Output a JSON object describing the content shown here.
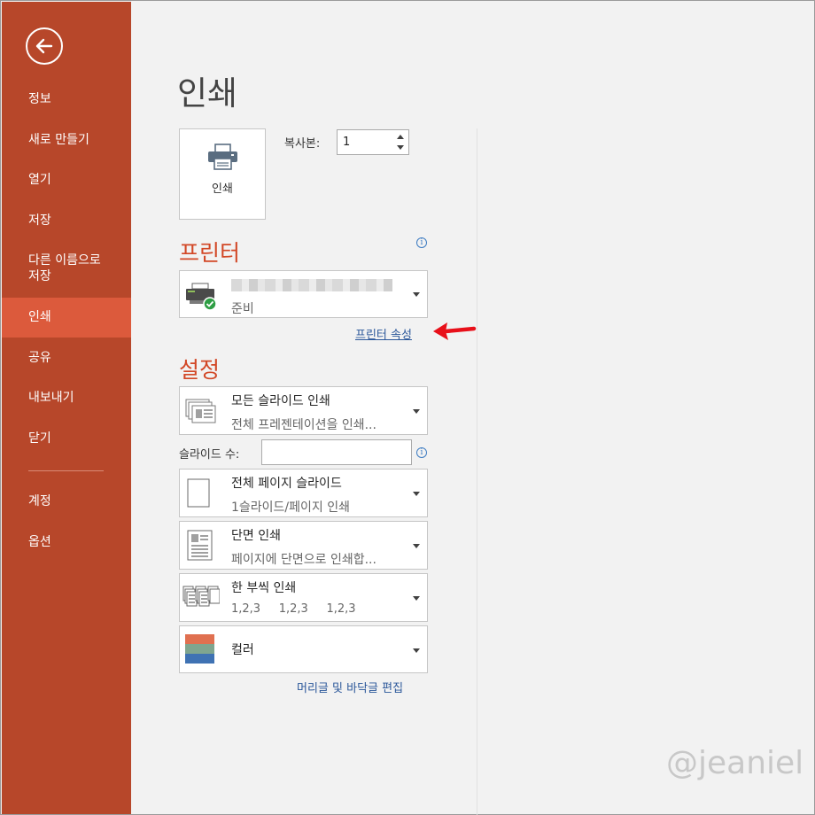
{
  "sidebar": {
    "items": [
      {
        "label": "정보"
      },
      {
        "label": "새로 만들기"
      },
      {
        "label": "열기"
      },
      {
        "label": "저장"
      },
      {
        "label": "다른 이름으로\n저장"
      },
      {
        "label": "인쇄"
      },
      {
        "label": "공유"
      },
      {
        "label": "내보내기"
      },
      {
        "label": "닫기"
      },
      {
        "label": "계정"
      },
      {
        "label": "옵션"
      }
    ],
    "active": "인쇄"
  },
  "main": {
    "title": "인쇄",
    "print_button_label": "인쇄",
    "copies": {
      "label": "복사본:",
      "value": "1"
    }
  },
  "printer": {
    "section_title": "프린터",
    "status": "준비",
    "properties_link": "프린터 속성"
  },
  "settings": {
    "section_title": "설정",
    "slides_dropdown": {
      "main": "모든 슬라이드 인쇄",
      "sub": "전체 프레젠테이션을 인쇄..."
    },
    "slide_count": {
      "label": "슬라이드 수:",
      "value": ""
    },
    "layout_dropdown": {
      "main": "전체 페이지 슬라이드",
      "sub": "1슬라이드/페이지 인쇄"
    },
    "sides_dropdown": {
      "main": "단면 인쇄",
      "sub": "페이지에 단면으로 인쇄합..."
    },
    "collate_dropdown": {
      "main": "한 부씩 인쇄",
      "sub": "1,2,3     1,2,3     1,2,3"
    },
    "color_dropdown": {
      "main": "컬러"
    },
    "header_footer_link": "머리글 및 바닥글 편집"
  },
  "watermark": "@jeaniel",
  "colors": {
    "sidebar_bg": "#b7472a",
    "sidebar_active": "#dc5a3c",
    "accent_title": "#d24726",
    "link": "#2b579a",
    "annotation_arrow": "#e8101a"
  },
  "icons": {
    "back": "back-arrow-icon",
    "print": "printer-icon",
    "info": "info-icon",
    "printer_device": "printer-ready-icon",
    "slides": "slides-stack-icon",
    "layout": "full-page-slide-icon",
    "sides": "single-sided-icon",
    "collate": "collated-icon",
    "color": "color-swatch-icon"
  }
}
